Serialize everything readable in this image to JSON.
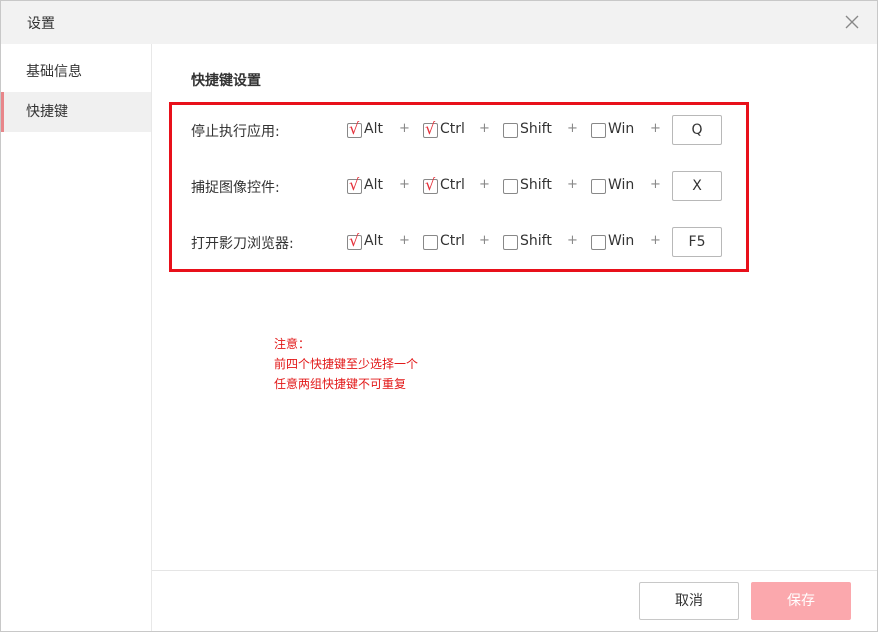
{
  "window": {
    "title": "设置"
  },
  "sidebar": {
    "items": [
      {
        "label": "基础信息",
        "active": false
      },
      {
        "label": "快捷键",
        "active": true
      }
    ]
  },
  "main": {
    "section_title": "快捷键设置",
    "shortcuts": [
      {
        "label": "停止执行应用:",
        "alt": true,
        "ctrl": true,
        "shift": false,
        "win": false,
        "key": "Q"
      },
      {
        "label": "捕捉图像控件:",
        "alt": true,
        "ctrl": true,
        "shift": false,
        "win": false,
        "key": "X"
      },
      {
        "label": "打开影刀浏览器:",
        "alt": true,
        "ctrl": false,
        "shift": false,
        "win": false,
        "key": "F5"
      }
    ],
    "modifier_labels": {
      "alt": "Alt",
      "ctrl": "Ctrl",
      "shift": "Shift",
      "win": "Win"
    },
    "plus_sign": "+",
    "notice": [
      "注意：",
      "前四个快捷键至少选择一个",
      "任意两组快捷键不可重复"
    ]
  },
  "footer": {
    "cancel_label": "取消",
    "save_label": "保存"
  },
  "colors": {
    "highlight_border": "#e8101a",
    "check_mark": "#e5303a",
    "notice_text": "#e21818",
    "save_button_bg": "#fba8ad",
    "active_indicator": "#e8868a"
  }
}
